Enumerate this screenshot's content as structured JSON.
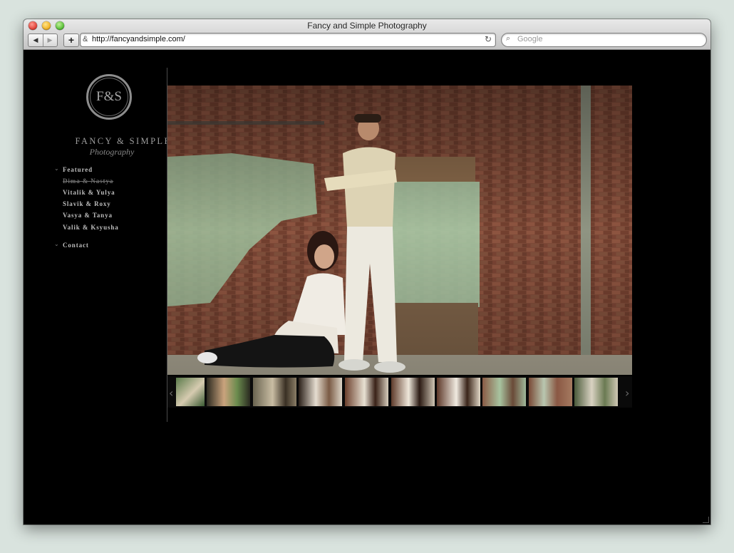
{
  "window": {
    "title": "Fancy and Simple Photography"
  },
  "toolbar": {
    "back_icon": "◀",
    "forward_icon": "▶",
    "add_icon": "+",
    "site_icon": "&",
    "url": "http://fancyandsimple.com/",
    "reload_icon": "↻",
    "search_icon": "⌕",
    "search_placeholder": "Google"
  },
  "site": {
    "logo_monogram": "F&S",
    "brand_name": "FANCY & SIMPLE",
    "brand_tagline": "Photography",
    "menu": [
      {
        "label": "Featured",
        "chevron": "⌄"
      },
      {
        "label": "Dima & Nastya"
      },
      {
        "label": "Vitalik & Yulya"
      },
      {
        "label": "Slavik & Roxy"
      },
      {
        "label": "Vasya & Tanya"
      },
      {
        "label": "Valik & Ksyusha"
      },
      {
        "label": "Contact",
        "chevron": "⌄"
      }
    ],
    "gallery": {
      "prev_arrow": "‹",
      "next_arrow": "›",
      "thumbnail_count": 10
    }
  },
  "colors": {
    "page_bg": "#000000",
    "menu_text": "#bdbdbd",
    "menu_disabled": "#6e6e6e",
    "desktop_bg": "#d9e3de"
  }
}
